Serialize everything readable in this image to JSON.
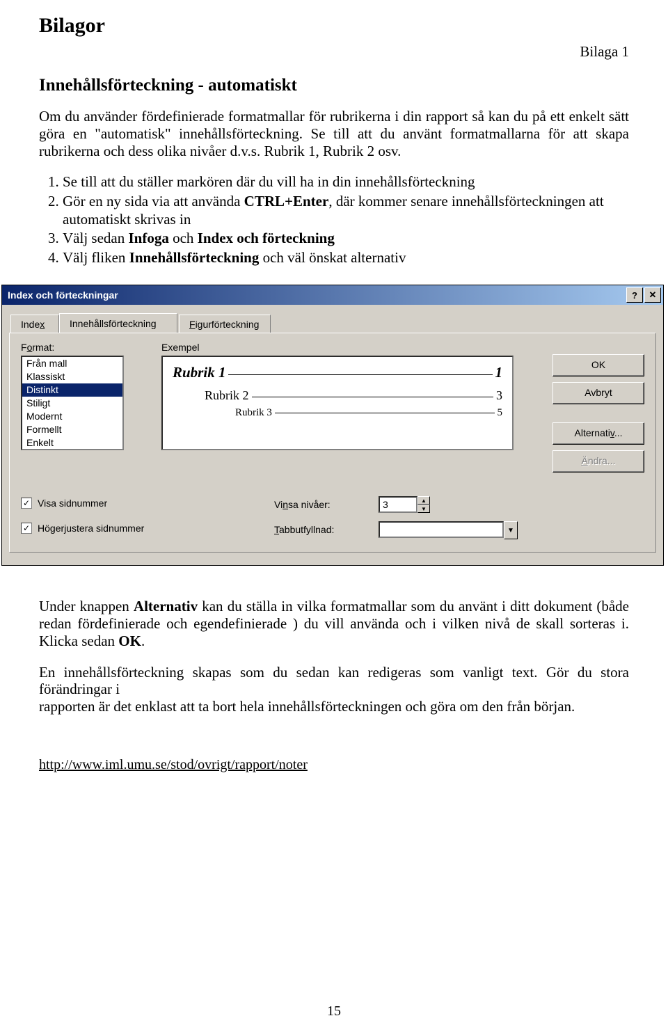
{
  "doc": {
    "heading": "Bilagor",
    "bilaga": "Bilaga 1",
    "subheading": "Innehållsförteckning - automatiskt",
    "para1": "Om du använder  fördefinierade formatmallar för rubrikerna i din rapport så kan du på ett enkelt sätt göra en \"automatisk\" innehållsförteckning. Se till att du använt formatmallarna för att skapa rubrikerna och dess olika nivåer d.v.s. Rubrik 1, Rubrik 2 osv.",
    "steps": {
      "s1": "Se till att du ställer markören där du vill ha in din innehållsförteckning",
      "s2a": "Gör en ny sida via att använda ",
      "s2b": "CTRL+Enter",
      "s2c": ", där kommer senare innehållsförteckningen att automatiskt skrivas in",
      "s3a": "Välj sedan ",
      "s3b": "Infoga",
      "s3c": " och ",
      "s3d": "Index och förteckning",
      "s4a": "Välj fliken ",
      "s4b": "Innehållsförteckning",
      "s4c": " och väl önskat alternativ"
    },
    "after1a": "Under knappen ",
    "after1b": "Alternativ",
    "after1c": " kan du ställa in vilka formatmallar som du använt i ditt dokument (både redan fördefinierade och egendefinierade ) du vill använda och i vilken nivå de skall sorteras i. Klicka sedan ",
    "after1d": "OK",
    "after1e": ".",
    "after2": "En innehållsförteckning skapas som du sedan kan redigeras som vanligt text. Gör du stora förändringar i",
    "after3": "rapporten är det enklast att ta bort hela innehållsförteckningen och göra om den från början.",
    "url": "http://www.iml.umu.se/stod/ovrigt/rapport/noter",
    "pagenum": "15"
  },
  "dlg": {
    "title": "Index och förteckningar",
    "help": "?",
    "close": "✕",
    "tabs": {
      "index": "Index",
      "toc": "Innehållsförteckning",
      "fig": "Figurförteckning",
      "index_u": "x",
      "fig_u": "F"
    },
    "labels": {
      "format": "Format:",
      "format_u": "o",
      "exempel": "Exempel",
      "visa_sidnr": "Visa sidnummer",
      "visa_sidnr_u": "s",
      "hoger": "Högerjustera sidnummer",
      "hoger_u": "H",
      "visa_niv": "Visa nivåer:",
      "visa_niv_u": "n",
      "tabb": "Tabbutfyllnad:",
      "tabb_u": "T"
    },
    "format_items": [
      "Från mall",
      "Klassiskt",
      "Distinkt",
      "Stiligt",
      "Modernt",
      "Formellt",
      "Enkelt"
    ],
    "format_sel": "Distinkt",
    "preview": {
      "r1": "Rubrik 1",
      "p1": "1",
      "r2": "Rubrik 2",
      "p2": "3",
      "r3": "Rubrik 3",
      "p3": "5"
    },
    "buttons": {
      "ok": "OK",
      "avbryt": "Avbryt",
      "alt": "Alternativ...",
      "alt_u": "v",
      "andra": "Ändra...",
      "andra_u": "Ä"
    },
    "niv_val": "3",
    "tabb_val": ""
  }
}
